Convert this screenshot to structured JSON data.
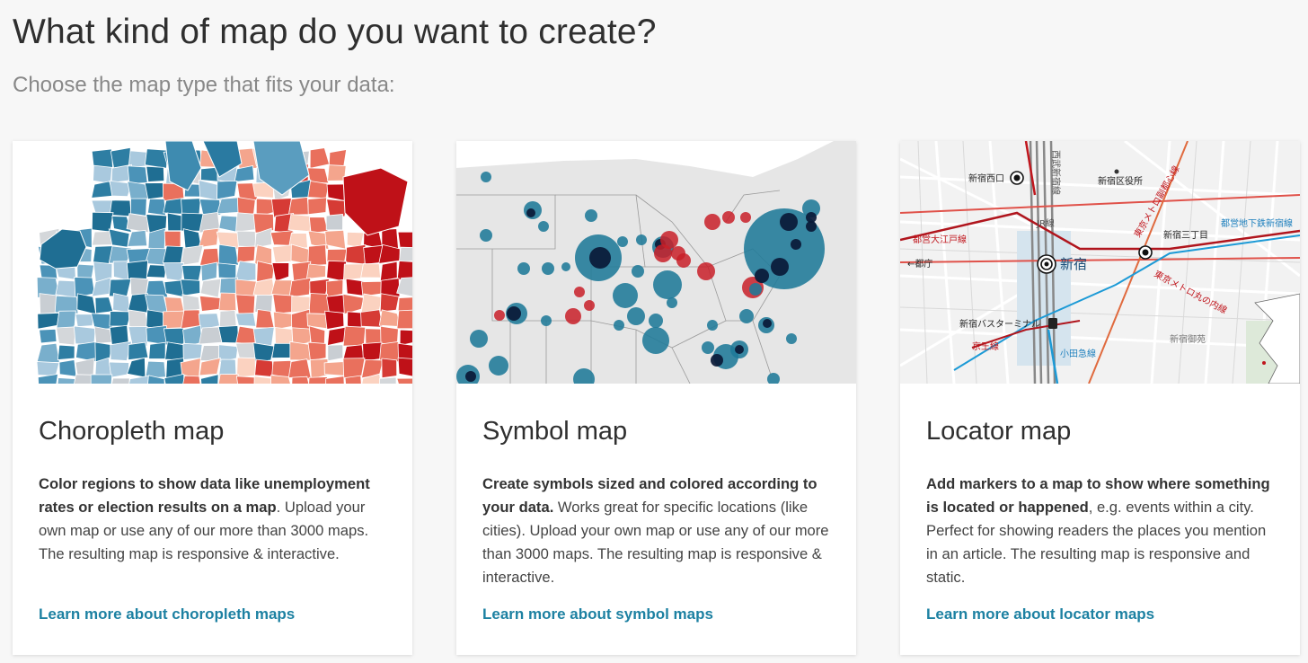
{
  "header": {
    "title": "What kind of map do you want to create?",
    "subtitle": "Choose the map type that fits your data:"
  },
  "cards": [
    {
      "title": "Choropleth map",
      "desc_bold": "Color regions to show data like unemployment rates or election results on a map",
      "desc_rest": ". Upload your own map or use any of our more than 3000 maps. The resulting map is responsive & interactive.",
      "link": "Learn more about choropleth maps"
    },
    {
      "title": "Symbol map",
      "desc_bold": "Create symbols sized and colored according to your data.",
      "desc_rest": " Works great for specific locations (like cities). Upload your own map or use any of our more than 3000 maps. The resulting map is responsive & interactive.",
      "link": "Learn more about symbol maps"
    },
    {
      "title": "Locator map",
      "desc_bold": "Add markers to a map to show where something is located or happened",
      "desc_rest": ", e.g. events within a city. Perfect for showing readers the places you mention in an article. The resulting map is responsive and static.",
      "link": "Learn more about locator maps"
    }
  ],
  "locator_labels": {
    "nishiguchi": "新宿西口",
    "kuyakusho": "新宿区役所",
    "seibu": "西武新宿線",
    "oedo": "都営大江戸線",
    "jr": "JR線",
    "shinjuku": "新宿",
    "sanchome": "新宿三丁目",
    "fukutoshin": "東京メトロ副都心線",
    "chikatetsu": "都営地下鉄新宿線",
    "tocho": "←都庁",
    "marunouchi": "東京メトロ丸の内線",
    "busta": "新宿バスターミナル",
    "keio": "京王線",
    "odakyu": "小田急線",
    "gyoen": "新宿御苑"
  },
  "colors": {
    "link": "#1d81a2",
    "choropleth_blue": "#2e7ea3",
    "choropleth_red": "#c0151c",
    "symbol_blue": "#1f7a98",
    "symbol_red": "#c81e28"
  }
}
